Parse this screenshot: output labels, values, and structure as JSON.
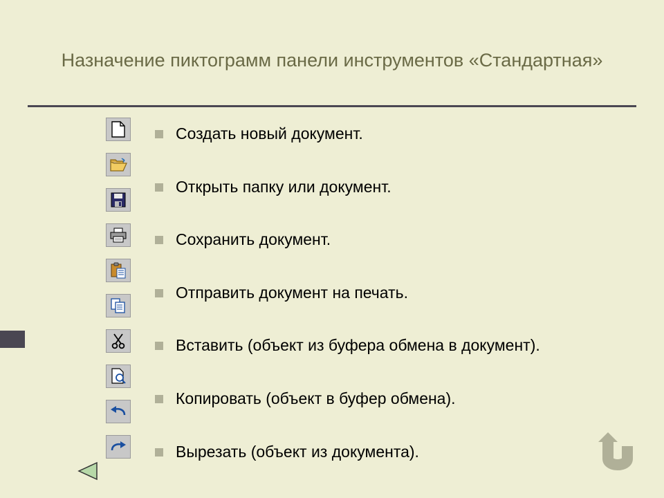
{
  "title": "Назначение пиктограмм панели инструментов «Стандартная»",
  "icon_names": [
    "new-document-icon",
    "open-folder-icon",
    "save-floppy-icon",
    "print-icon",
    "paste-clipboard-icon",
    "copy-icon",
    "cut-scissors-icon",
    "print-preview-icon",
    "undo-icon",
    "redo-icon"
  ],
  "items": [
    "Создать новый документ.",
    "Открыть папку или документ.",
    "Сохранить документ.",
    "Отправить документ на печать.",
    "Вставить (объект из буфера обмена в документ).",
    "Копировать (объект в буфер обмена).",
    "Вырезать (объект из документа)."
  ]
}
